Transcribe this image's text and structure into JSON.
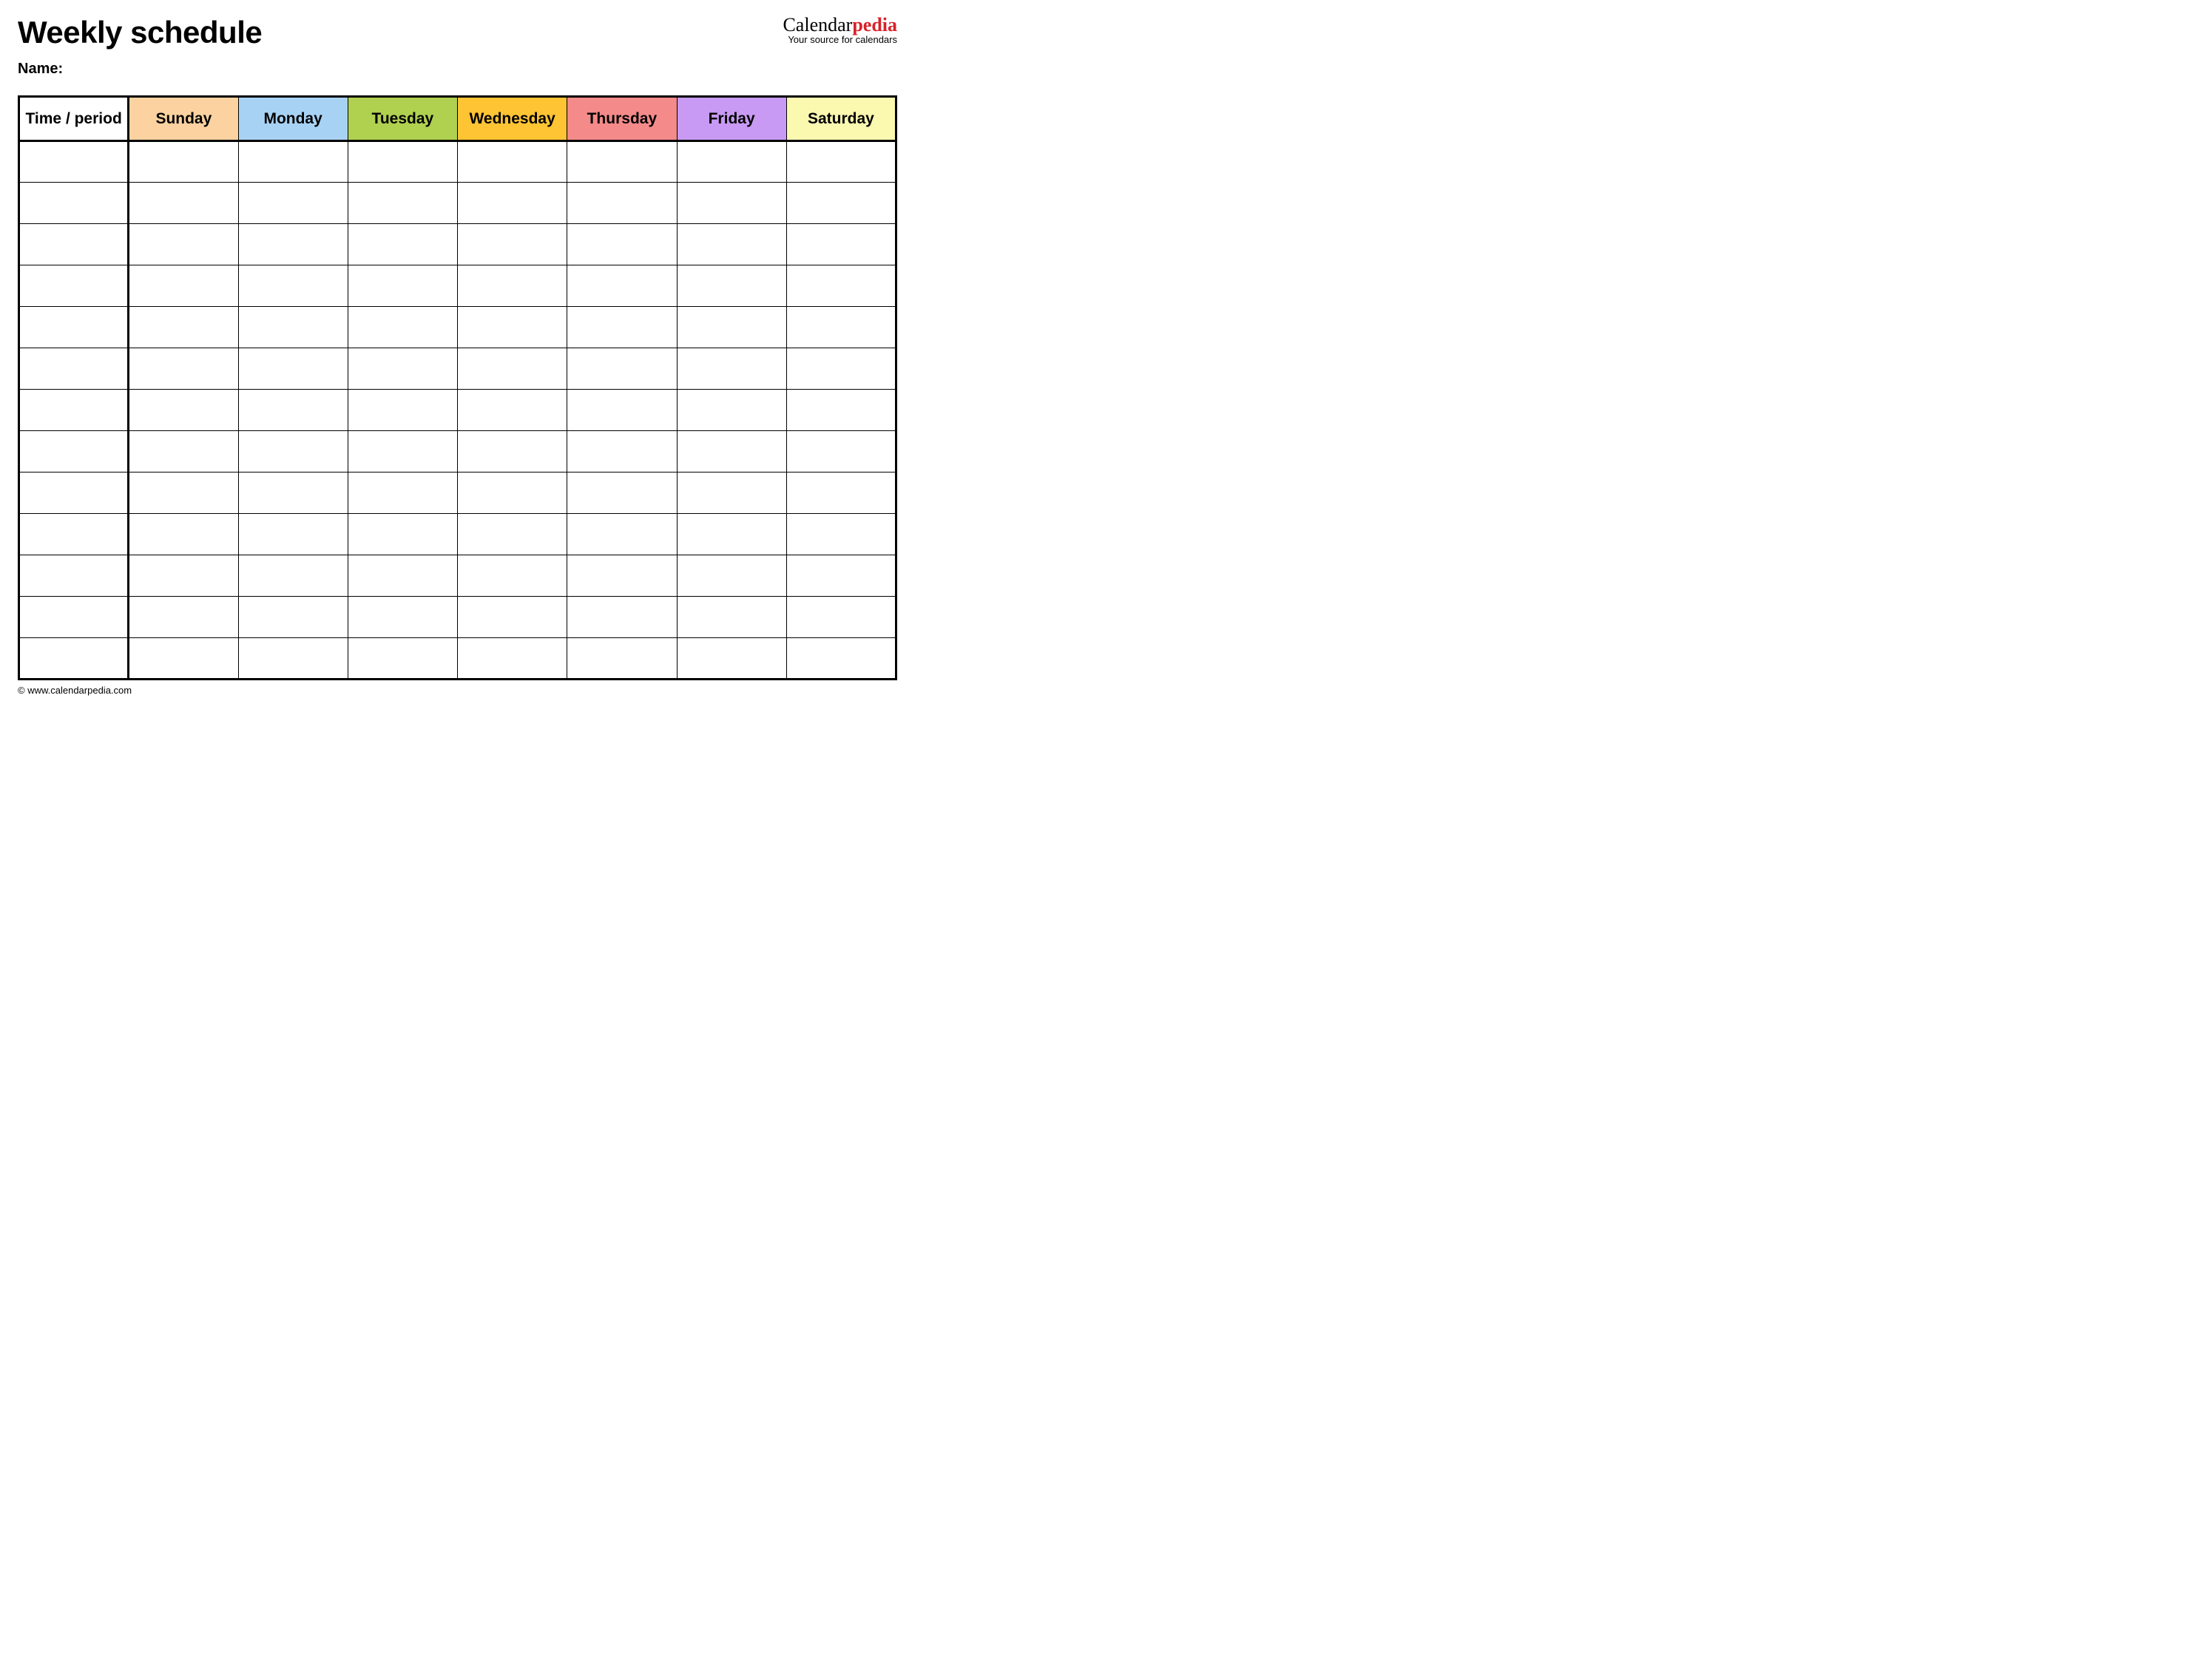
{
  "header": {
    "title": "Weekly schedule",
    "name_label": "Name:",
    "name_value": ""
  },
  "brand": {
    "part1": "Calendar",
    "part2": "pedia",
    "tagline": "Your source for calendars"
  },
  "columns": [
    {
      "label": "Time / period",
      "bg": "#ffffff"
    },
    {
      "label": "Sunday",
      "bg": "#fbd2a0"
    },
    {
      "label": "Monday",
      "bg": "#a8d2f4"
    },
    {
      "label": "Tuesday",
      "bg": "#b0d050"
    },
    {
      "label": "Wednesday",
      "bg": "#ffc434"
    },
    {
      "label": "Thursday",
      "bg": "#f48a8a"
    },
    {
      "label": "Friday",
      "bg": "#c89af4"
    },
    {
      "label": "Saturday",
      "bg": "#fbf8b0"
    }
  ],
  "rows": [
    [
      "",
      "",
      "",
      "",
      "",
      "",
      "",
      ""
    ],
    [
      "",
      "",
      "",
      "",
      "",
      "",
      "",
      ""
    ],
    [
      "",
      "",
      "",
      "",
      "",
      "",
      "",
      ""
    ],
    [
      "",
      "",
      "",
      "",
      "",
      "",
      "",
      ""
    ],
    [
      "",
      "",
      "",
      "",
      "",
      "",
      "",
      ""
    ],
    [
      "",
      "",
      "",
      "",
      "",
      "",
      "",
      ""
    ],
    [
      "",
      "",
      "",
      "",
      "",
      "",
      "",
      ""
    ],
    [
      "",
      "",
      "",
      "",
      "",
      "",
      "",
      ""
    ],
    [
      "",
      "",
      "",
      "",
      "",
      "",
      "",
      ""
    ],
    [
      "",
      "",
      "",
      "",
      "",
      "",
      "",
      ""
    ],
    [
      "",
      "",
      "",
      "",
      "",
      "",
      "",
      ""
    ],
    [
      "",
      "",
      "",
      "",
      "",
      "",
      "",
      ""
    ],
    [
      "",
      "",
      "",
      "",
      "",
      "",
      "",
      ""
    ]
  ],
  "footer": {
    "copyright": "© www.calendarpedia.com"
  }
}
